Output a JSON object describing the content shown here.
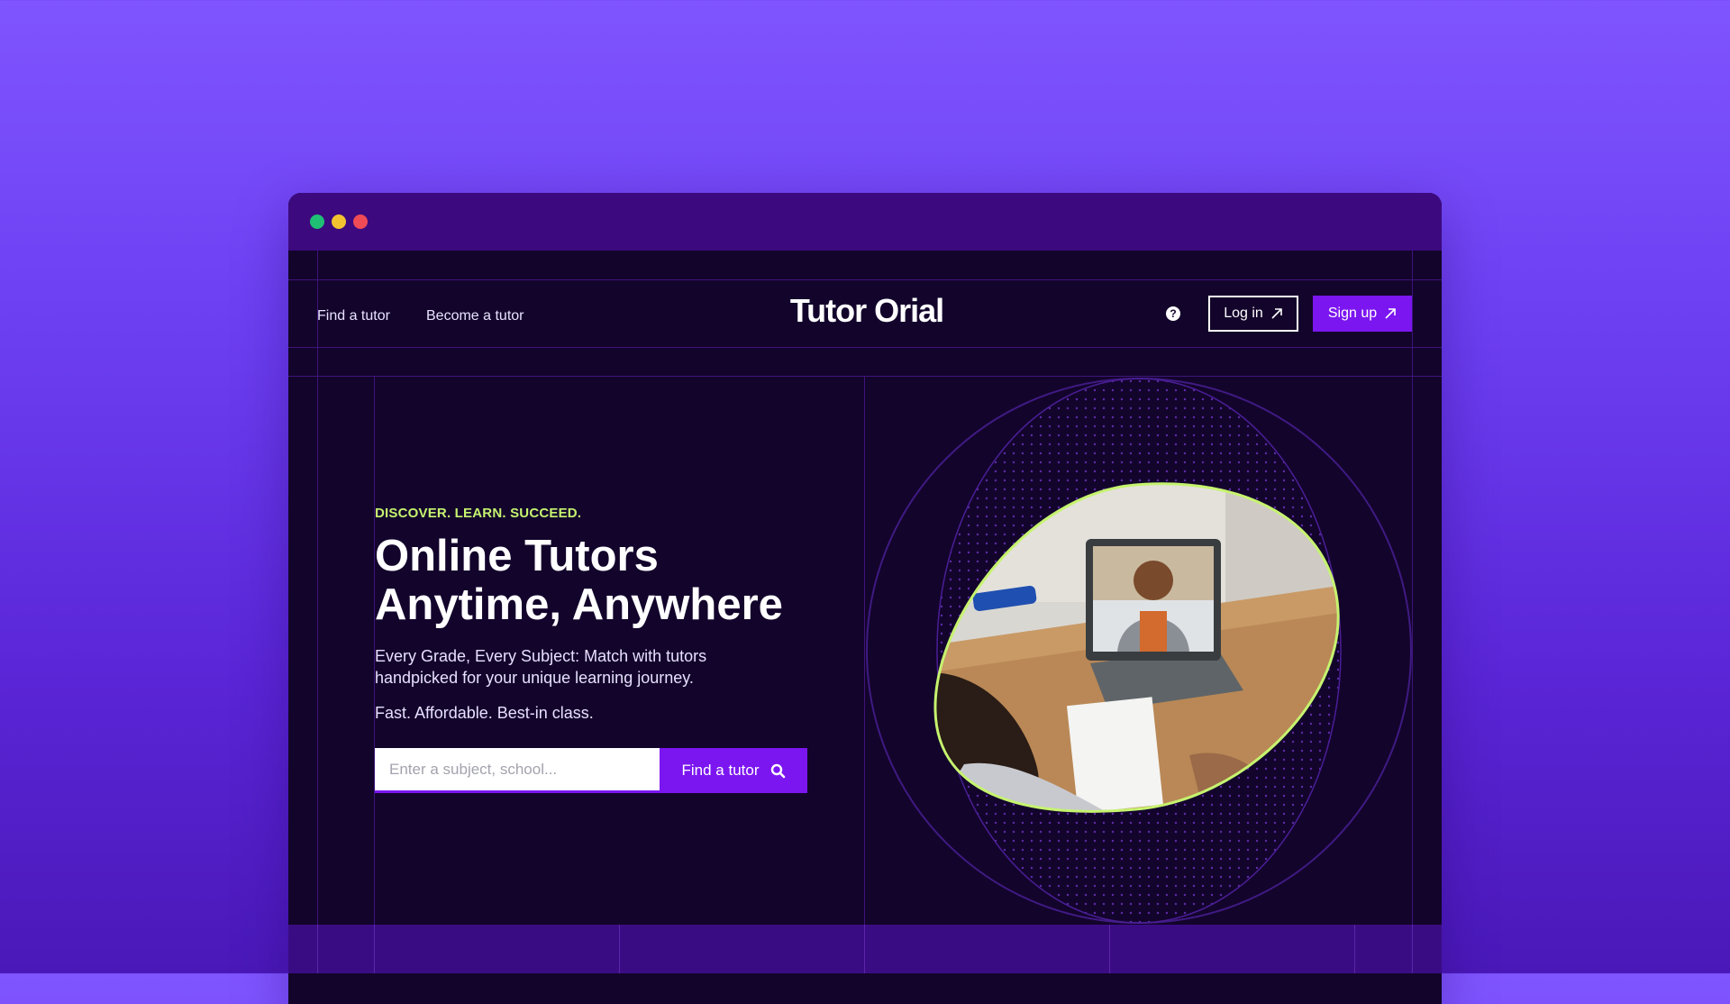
{
  "window": {
    "controls": [
      "green",
      "yellow",
      "red"
    ]
  },
  "nav": {
    "links": [
      "Find a tutor",
      "Become a tutor"
    ],
    "logo": "Tutor Orial",
    "help_icon": "question-circle-icon",
    "login_label": "Log in",
    "signup_label": "Sign up"
  },
  "hero": {
    "eyebrow": "DISCOVER. LEARN. SUCCEED.",
    "headline_line1": "Online Tutors",
    "headline_line2": "Anytime, Anywhere",
    "subtext_line1": "Every Grade, Every Subject: Match with tutors",
    "subtext_line2": "handpicked for your unique learning journey.",
    "tagline": "Fast. Affordable. Best-in class.",
    "search": {
      "placeholder": "Enter a subject, school...",
      "value": "",
      "button_label": "Find a tutor",
      "button_icon": "search-icon"
    },
    "image": "girl-video-call-with-tutor-photo"
  },
  "colors": {
    "page_bg": "#7f55ff",
    "window_bg": "#13042c",
    "titlebar": "#3c0a7e",
    "accent": "#7b16f0",
    "eyebrow": "#c6f36f",
    "grid_lines": "#3e1479"
  }
}
